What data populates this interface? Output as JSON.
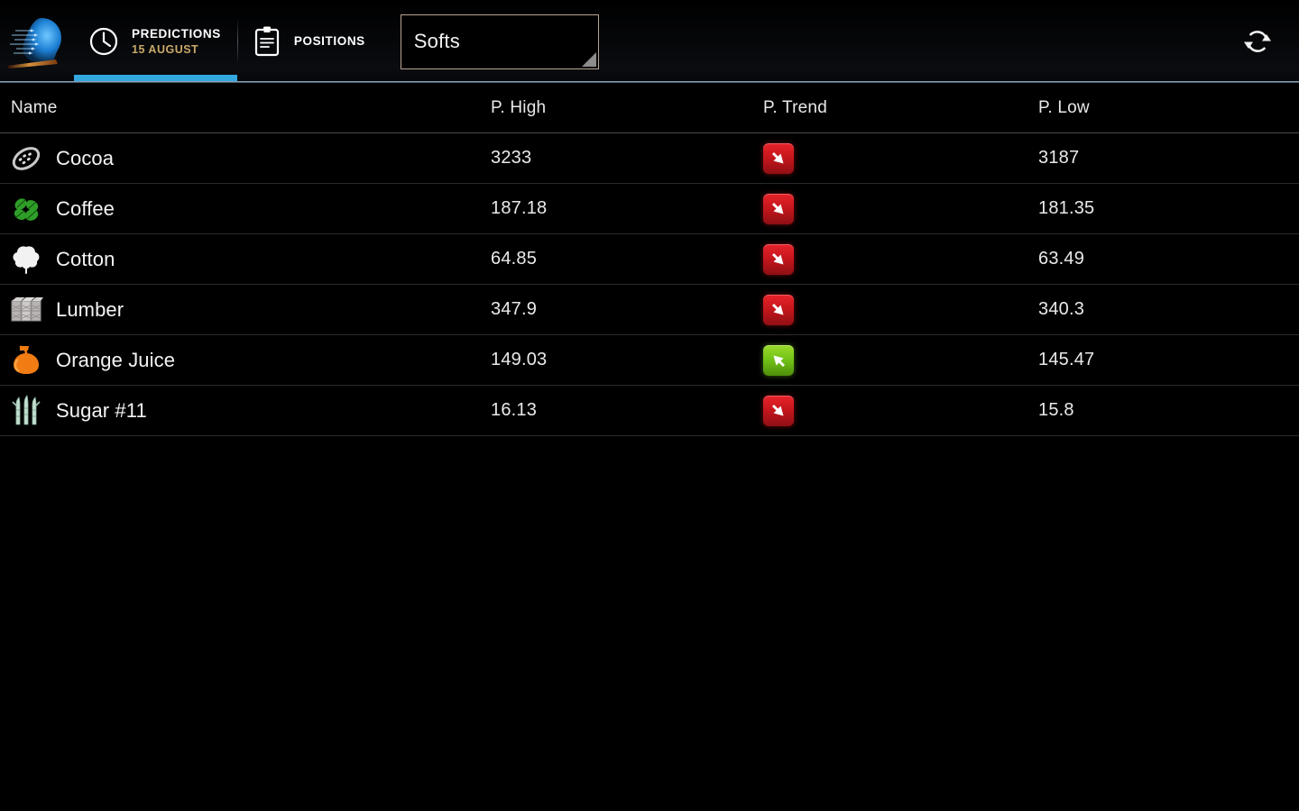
{
  "app": {
    "logo_icon": "ai-head-logo",
    "background_color": "#000000",
    "accent_color": "#33a7e0"
  },
  "topbar": {
    "tabs": [
      {
        "id": "predictions",
        "icon": "clock-icon",
        "title": "PREDICTIONS",
        "subtitle": "15 AUGUST",
        "active": true
      },
      {
        "id": "positions",
        "icon": "clipboard-icon",
        "title": "POSITIONS",
        "subtitle": "",
        "active": false
      }
    ],
    "category_spinner": {
      "icon": "chevron-down-icon",
      "selected": "Softs",
      "options": [
        "Softs"
      ]
    },
    "refresh": {
      "icon": "refresh-icon",
      "label": "Refresh"
    }
  },
  "table": {
    "columns": [
      {
        "key": "name",
        "label": "Name"
      },
      {
        "key": "high",
        "label": "P. High"
      },
      {
        "key": "trend",
        "label": "P. Trend"
      },
      {
        "key": "low",
        "label": "P. Low"
      }
    ],
    "rows": [
      {
        "icon": "cocoa-icon",
        "name": "Cocoa",
        "high": "3233",
        "trend": "down",
        "low": "3187"
      },
      {
        "icon": "coffee-icon",
        "name": "Coffee",
        "high": "187.18",
        "trend": "down",
        "low": "181.35"
      },
      {
        "icon": "cotton-icon",
        "name": "Cotton",
        "high": "64.85",
        "trend": "down",
        "low": "63.49"
      },
      {
        "icon": "lumber-icon",
        "name": "Lumber",
        "high": "347.9",
        "trend": "down",
        "low": "340.3"
      },
      {
        "icon": "orange-juice-icon",
        "name": "Orange Juice",
        "high": "149.03",
        "trend": "up",
        "low": "145.47"
      },
      {
        "icon": "sugar-icon",
        "name": "Sugar #11",
        "high": "16.13",
        "trend": "down",
        "low": "15.8"
      }
    ],
    "trend_colors": {
      "down": "#c4161c",
      "up": "#71c217"
    }
  }
}
